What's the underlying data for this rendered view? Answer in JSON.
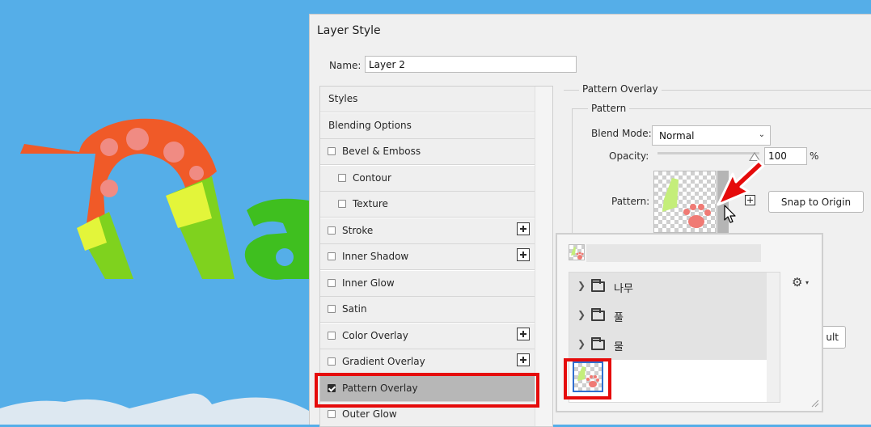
{
  "colors": {
    "canvas_blue": "#55aee8",
    "dialog_bg": "#f0f0f0",
    "highlight_red": "#e50b0b",
    "selection_gray": "#b7b7b7",
    "selected_preset_border": "#2f6fd0"
  },
  "dialog": {
    "title": "Layer Style",
    "name_label": "Name:",
    "name_value": "Layer 2"
  },
  "styles": [
    {
      "label": "Styles",
      "checkbox": false,
      "indent": false,
      "plus": false,
      "checked": false,
      "selected": false
    },
    {
      "label": "Blending Options",
      "checkbox": false,
      "indent": false,
      "plus": false,
      "checked": false,
      "selected": false
    },
    {
      "label": "Bevel & Emboss",
      "checkbox": true,
      "indent": false,
      "plus": false,
      "checked": false,
      "selected": false
    },
    {
      "label": "Contour",
      "checkbox": true,
      "indent": true,
      "plus": false,
      "checked": false,
      "selected": false
    },
    {
      "label": "Texture",
      "checkbox": true,
      "indent": true,
      "plus": false,
      "checked": false,
      "selected": false
    },
    {
      "label": "Stroke",
      "checkbox": true,
      "indent": false,
      "plus": true,
      "checked": false,
      "selected": false
    },
    {
      "label": "Inner Shadow",
      "checkbox": true,
      "indent": false,
      "plus": true,
      "checked": false,
      "selected": false
    },
    {
      "label": "Inner Glow",
      "checkbox": true,
      "indent": false,
      "plus": false,
      "checked": false,
      "selected": false
    },
    {
      "label": "Satin",
      "checkbox": true,
      "indent": false,
      "plus": false,
      "checked": false,
      "selected": false
    },
    {
      "label": "Color Overlay",
      "checkbox": true,
      "indent": false,
      "plus": true,
      "checked": false,
      "selected": false
    },
    {
      "label": "Gradient Overlay",
      "checkbox": true,
      "indent": false,
      "plus": true,
      "checked": false,
      "selected": false
    },
    {
      "label": "Pattern Overlay",
      "checkbox": true,
      "indent": false,
      "plus": false,
      "checked": true,
      "selected": true
    },
    {
      "label": "Outer Glow",
      "checkbox": true,
      "indent": false,
      "plus": false,
      "checked": false,
      "selected": false
    }
  ],
  "pattern_overlay": {
    "section_title": "Pattern Overlay",
    "group_title": "Pattern",
    "blend_mode_label": "Blend Mode:",
    "blend_mode_value": "Normal",
    "opacity_label": "Opacity:",
    "opacity_value": "100",
    "opacity_unit": "%",
    "opacity_level": 1.0,
    "pattern_label": "Pattern:",
    "snap_button": "Snap to Origin",
    "partial_button": "ult"
  },
  "picker": {
    "folders": [
      {
        "name": "나무"
      },
      {
        "name": "풀"
      },
      {
        "name": "물"
      }
    ]
  },
  "icons": {
    "gear": "gear-icon",
    "folder": "folder-icon",
    "chevron": "chevron-right-icon",
    "new_preset": "new-preset-plus-icon",
    "arrow": "red-arrow-annotation",
    "cursor": "mouse-pointer-icon"
  }
}
